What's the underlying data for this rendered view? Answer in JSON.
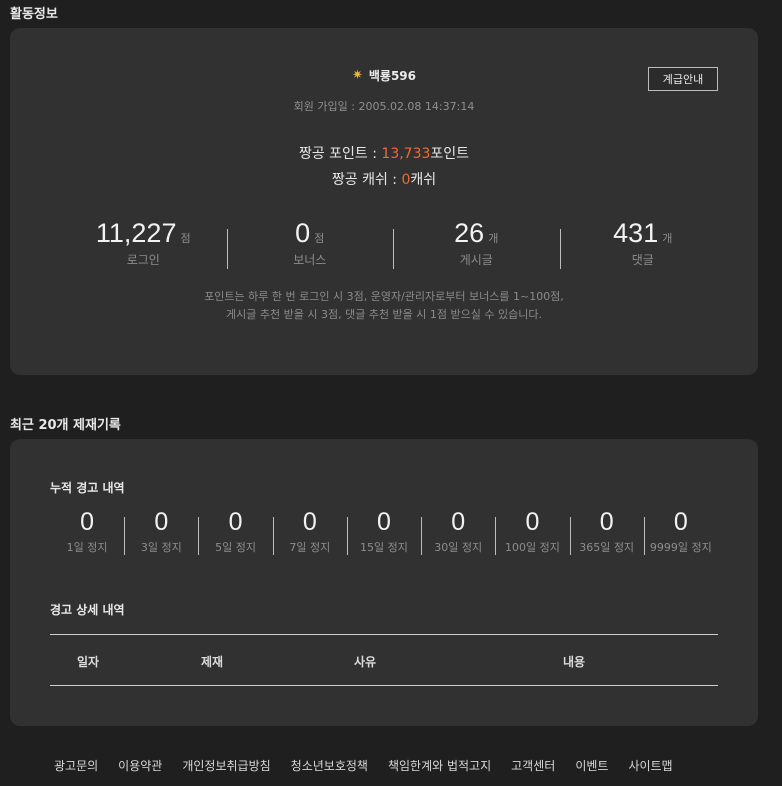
{
  "activity": {
    "title": "활동정보",
    "nickname": "백룡596",
    "level_button": "계급안내",
    "join_date": "회원 가입일 : 2005.02.08 14:37:14",
    "points_label": "짱공 포인트 : ",
    "points_value": "13,733",
    "points_unit": "포인트",
    "cash_label": "짱공 캐쉬 : ",
    "cash_value": "0",
    "cash_unit": "캐쉬",
    "stats": [
      {
        "value": "11,227",
        "unit": "점",
        "label": "로그인"
      },
      {
        "value": "0",
        "unit": "점",
        "label": "보너스"
      },
      {
        "value": "26",
        "unit": "개",
        "label": "게시글"
      },
      {
        "value": "431",
        "unit": "개",
        "label": "댓글"
      }
    ],
    "notice_line1": "포인트는 하루 한 번 로그인 시 3점, 운영자/관리자로부터 보너스를 1~100점,",
    "notice_line2": "게시글 추천 받을 시 3점, 댓글 추천 받을 시 1점 받으실 수 있습니다."
  },
  "sanctions": {
    "title": "최근 20개 제재기록",
    "cumulative_title": "누적 경고 내역",
    "counts": [
      {
        "value": "0",
        "label": "1일 정지"
      },
      {
        "value": "0",
        "label": "3일 정지"
      },
      {
        "value": "0",
        "label": "5일 정지"
      },
      {
        "value": "0",
        "label": "7일 정지"
      },
      {
        "value": "0",
        "label": "15일 정지"
      },
      {
        "value": "0",
        "label": "30일 정지"
      },
      {
        "value": "0",
        "label": "100일 정지"
      },
      {
        "value": "0",
        "label": "365일 정지"
      },
      {
        "value": "0",
        "label": "9999일 정지"
      }
    ],
    "detail_title": "경고 상세 내역",
    "columns": [
      "일자",
      "제재",
      "사유",
      "내용"
    ]
  },
  "footer": {
    "links": [
      "광고문의",
      "이용약관",
      "개인정보취급방침",
      "청소년보호정책",
      "책임한계와 법적고지",
      "고객센터",
      "이벤트",
      "사이트맵"
    ]
  }
}
